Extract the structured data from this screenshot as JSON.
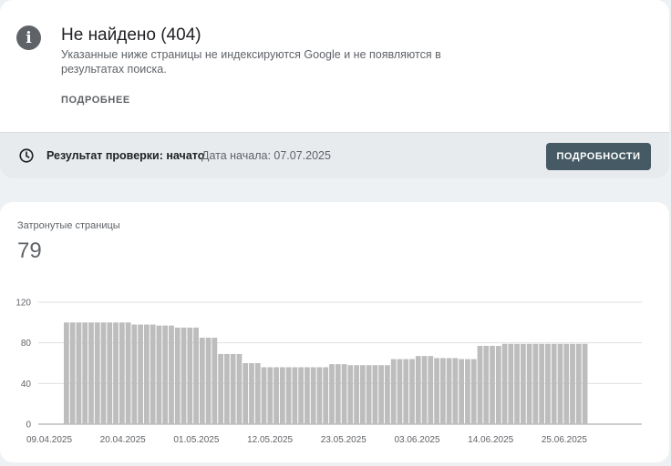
{
  "header": {
    "title": "Не найдено (404)",
    "description": "Указанные ниже страницы не индексируются Google и не появляются в результатах поиска.",
    "more_link": "ПОДРОБНЕЕ",
    "info_icon": "info-icon"
  },
  "status": {
    "label": "Результат проверки: начато",
    "date_text": "Дата начала: 07.07.2025",
    "button": "ПОДРОБНОСТИ",
    "icon": "clock-icon"
  },
  "affected": {
    "label": "Затронутые страницы",
    "value": "79"
  },
  "colors": {
    "bar": "#bdbdbd",
    "button": "#455a64",
    "grid": "#e0e0e0"
  },
  "chart_data": {
    "type": "bar",
    "ylim": [
      0,
      120
    ],
    "yticks": [
      0,
      40,
      80,
      120
    ],
    "grid": true,
    "x_tick_labels": [
      "09.04.2025",
      "20.04.2025",
      "01.05.2025",
      "12.05.2025",
      "23.05.2025",
      "03.06.2025",
      "14.06.2025",
      "25.06.2025"
    ],
    "values": [
      null,
      null,
      null,
      null,
      null,
      100,
      100,
      100,
      100,
      100,
      100,
      100,
      100,
      100,
      100,
      100,
      98,
      98,
      98,
      98,
      97,
      97,
      97,
      95,
      95,
      95,
      95,
      85,
      85,
      85,
      69,
      69,
      69,
      69,
      60,
      60,
      60,
      56,
      56,
      56,
      56,
      56,
      56,
      56,
      56,
      56,
      56,
      56,
      59,
      59,
      59,
      58,
      58,
      58,
      58,
      58,
      58,
      58,
      64,
      64,
      64,
      64,
      67,
      67,
      67,
      65,
      65,
      65,
      65,
      64,
      64,
      64,
      77,
      77,
      77,
      77,
      79,
      79,
      79,
      79,
      79,
      79,
      79,
      79,
      79,
      79,
      79,
      79,
      79,
      79
    ]
  }
}
